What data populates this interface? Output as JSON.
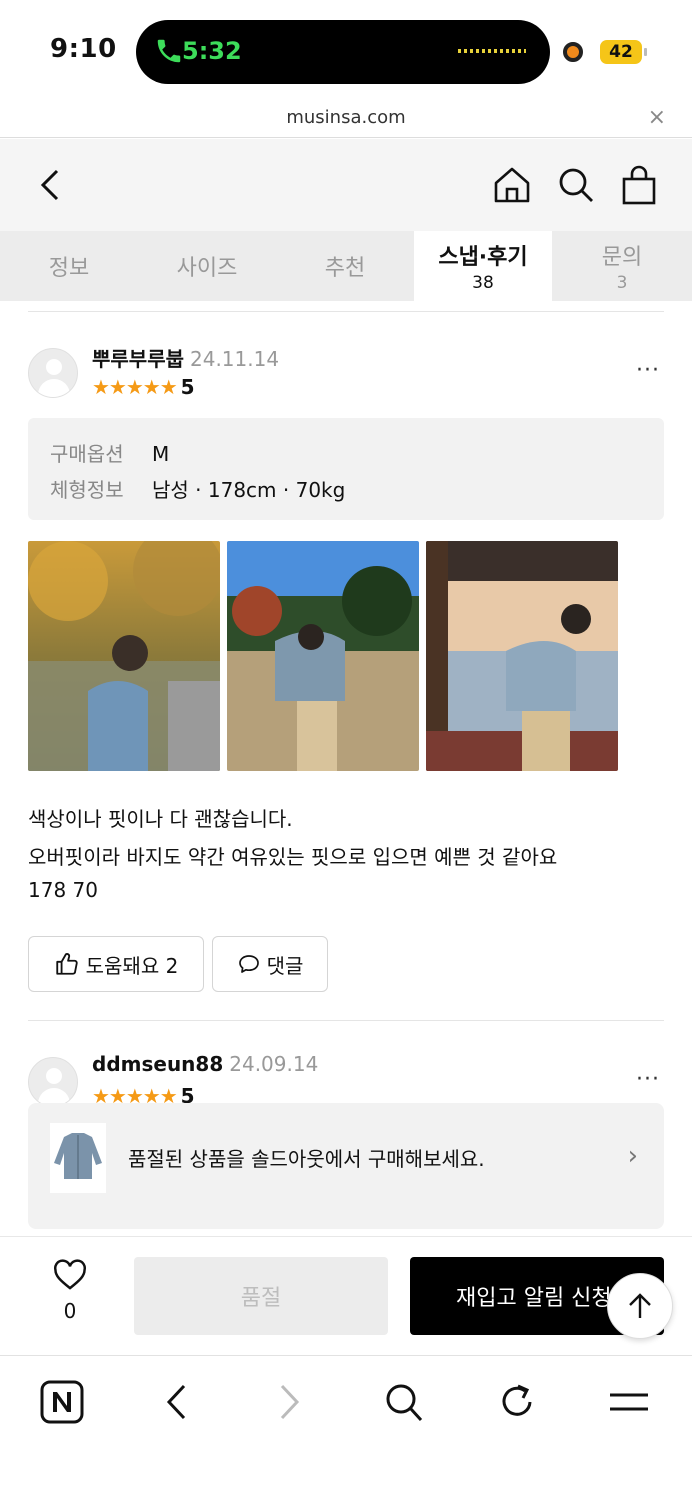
{
  "status_bar": {
    "time": "9:10",
    "call_time": "5:32",
    "battery": "42"
  },
  "browser": {
    "url": "musinsa.com",
    "close_label": "×"
  },
  "tabs": [
    {
      "label": "정보",
      "count": ""
    },
    {
      "label": "사이즈",
      "count": ""
    },
    {
      "label": "추천",
      "count": ""
    },
    {
      "label": "스냅·후기",
      "count": "38"
    },
    {
      "label": "문의",
      "count": "3"
    }
  ],
  "reviews": [
    {
      "user": "뿌루부루붑",
      "date": "24.11.14",
      "stars": "★★★★★",
      "score": "5",
      "option_label": "구매옵션",
      "option_value": "M",
      "body_label": "체형정보",
      "body_value": "남성 · 178cm · 70kg",
      "lines": [
        "색상이나 핏이나 다 괜찮습니다.",
        "오버핏이라 바지도 약간 여유있는 핏으로 입으면 예쁜 것 같아요",
        "178 70"
      ],
      "helpful_label": "도움돼요 2",
      "comment_label": "댓글"
    },
    {
      "user": "ddmseun88",
      "date": "24.09.14",
      "stars": "★★★★★",
      "score": "5"
    }
  ],
  "more_label": "···",
  "banner": {
    "text": "품절된 상품을 솔드아웃에서 구매해보세요.",
    "chevron": "›"
  },
  "action": {
    "like_count": "0",
    "soldout_label": "품절",
    "restock_label": "재입고 알림 신청"
  },
  "colors": {
    "star": "#f59a16",
    "call_green": "#3ddc5a",
    "battery": "#f5c518"
  }
}
